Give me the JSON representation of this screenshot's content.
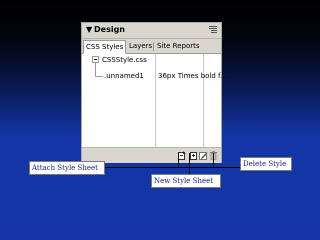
{
  "panel": {
    "title": "Design",
    "collapse_glyph": "▼",
    "tabs": [
      {
        "label": "CSS Styles",
        "active": true
      },
      {
        "label": "Layers",
        "active": false
      },
      {
        "label": "Site Reports",
        "active": false
      }
    ],
    "tree": {
      "file": "CSSStyle.css",
      "style_name": ".unnamed1",
      "style_desc": "36px Times bold f..."
    },
    "footer_icons": [
      "attach-stylesheet-icon",
      "new-style-icon",
      "edit-style-icon",
      "delete-style-icon"
    ]
  },
  "callouts": {
    "attach": "Attach Style Sheet",
    "new_style": "New Style Sheet",
    "delete": "Delete Style"
  },
  "colors": {
    "panel_chrome": "#d9d6cd",
    "callout_text": "#17238a",
    "background_blue": "#1535a6"
  }
}
